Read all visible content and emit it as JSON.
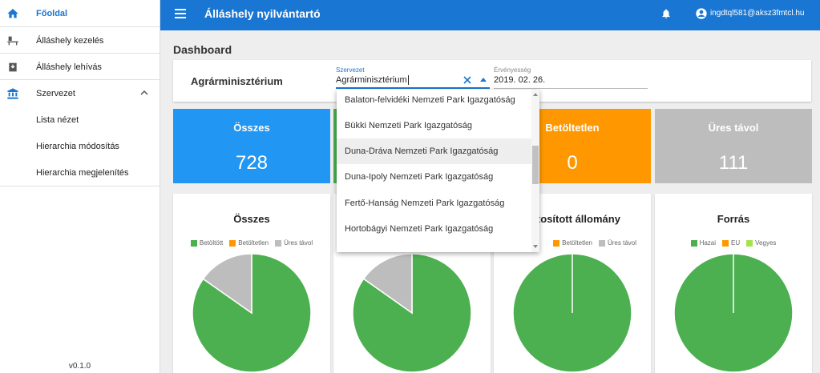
{
  "sidebar": {
    "items": [
      {
        "label": "Főoldal",
        "icon": "home-icon"
      },
      {
        "label": "Álláshely kezelés",
        "icon": "desk-icon"
      },
      {
        "label": "Álláshely lehívás",
        "icon": "download-box-icon"
      },
      {
        "label": "Szervezet",
        "icon": "bank-icon"
      }
    ],
    "sub_items": [
      "Lista nézet",
      "Hierarchia módosítás",
      "Hierarchia megjelenítés"
    ],
    "version": "v0.1.0"
  },
  "topbar": {
    "title": "Álláshely nyilvántartó",
    "user": "ingdtql581@aksz3fmtcl.hu"
  },
  "page_title": "Dashboard",
  "filter": {
    "org_name": "Agrárminisztérium",
    "org_label": "Szervezet",
    "org_value": "Agrárminisztérium",
    "date_label": "Érvényesség",
    "date_value": "2019. 02. 26."
  },
  "dropdown": {
    "options": [
      "Balaton-felvidéki Nemzeti Park Igazgatóság",
      "Bükki Nemzeti Park Igazgatóság",
      "Duna-Dráva Nemzeti Park Igazgatóság",
      "Duna-Ipoly Nemzeti Park Igazgatóság",
      "Fertő-Hanság Nemzeti Park Igazgatóság",
      "Hortobágyi Nemzeti Park Igazgatóság"
    ],
    "highlighted_index": 2
  },
  "stats": [
    {
      "label": "Összes",
      "value": "728",
      "color": "#2196f3"
    },
    {
      "label": "",
      "value": "",
      "color": "#4caf50"
    },
    {
      "label": "Betöltetlen",
      "value": "0",
      "color": "#ff9800"
    },
    {
      "label": "Üres távol",
      "value": "111",
      "color": "#bdbdbd"
    }
  ],
  "colors": {
    "green": "#4caf50",
    "orange": "#ff9800",
    "grey": "#bdbdbd",
    "lime": "#a5e34c"
  },
  "charts": [
    {
      "title": "Összes",
      "legend": [
        "Betöltött",
        "Betöltetlen",
        "Üres távol"
      ],
      "chart_data": {
        "type": "pie",
        "categories": [
          "Betöltött",
          "Betöltetlen",
          "Üres távol"
        ],
        "values": [
          617,
          0,
          111
        ]
      }
    },
    {
      "title": "",
      "legend": [],
      "chart_data": {
        "type": "pie",
        "categories": [
          "Betöltött",
          "Betöltetlen",
          "Üres távol"
        ],
        "values": [
          84.8,
          0,
          15.2
        ]
      }
    },
    {
      "title": "ontosított állomány",
      "legend": [
        "Betöltetlen",
        "Üres távol"
      ],
      "chart_data": {
        "type": "pie",
        "categories": [
          "Betöltött",
          "Betöltetlen",
          "Üres távol"
        ],
        "values": [
          100,
          0,
          0
        ]
      }
    },
    {
      "title": "Forrás",
      "legend": [
        "Hazai",
        "EU",
        "Vegyes"
      ],
      "chart_data": {
        "type": "pie",
        "categories": [
          "Hazai",
          "EU",
          "Vegyes"
        ],
        "values": [
          100,
          0,
          0
        ]
      }
    }
  ]
}
